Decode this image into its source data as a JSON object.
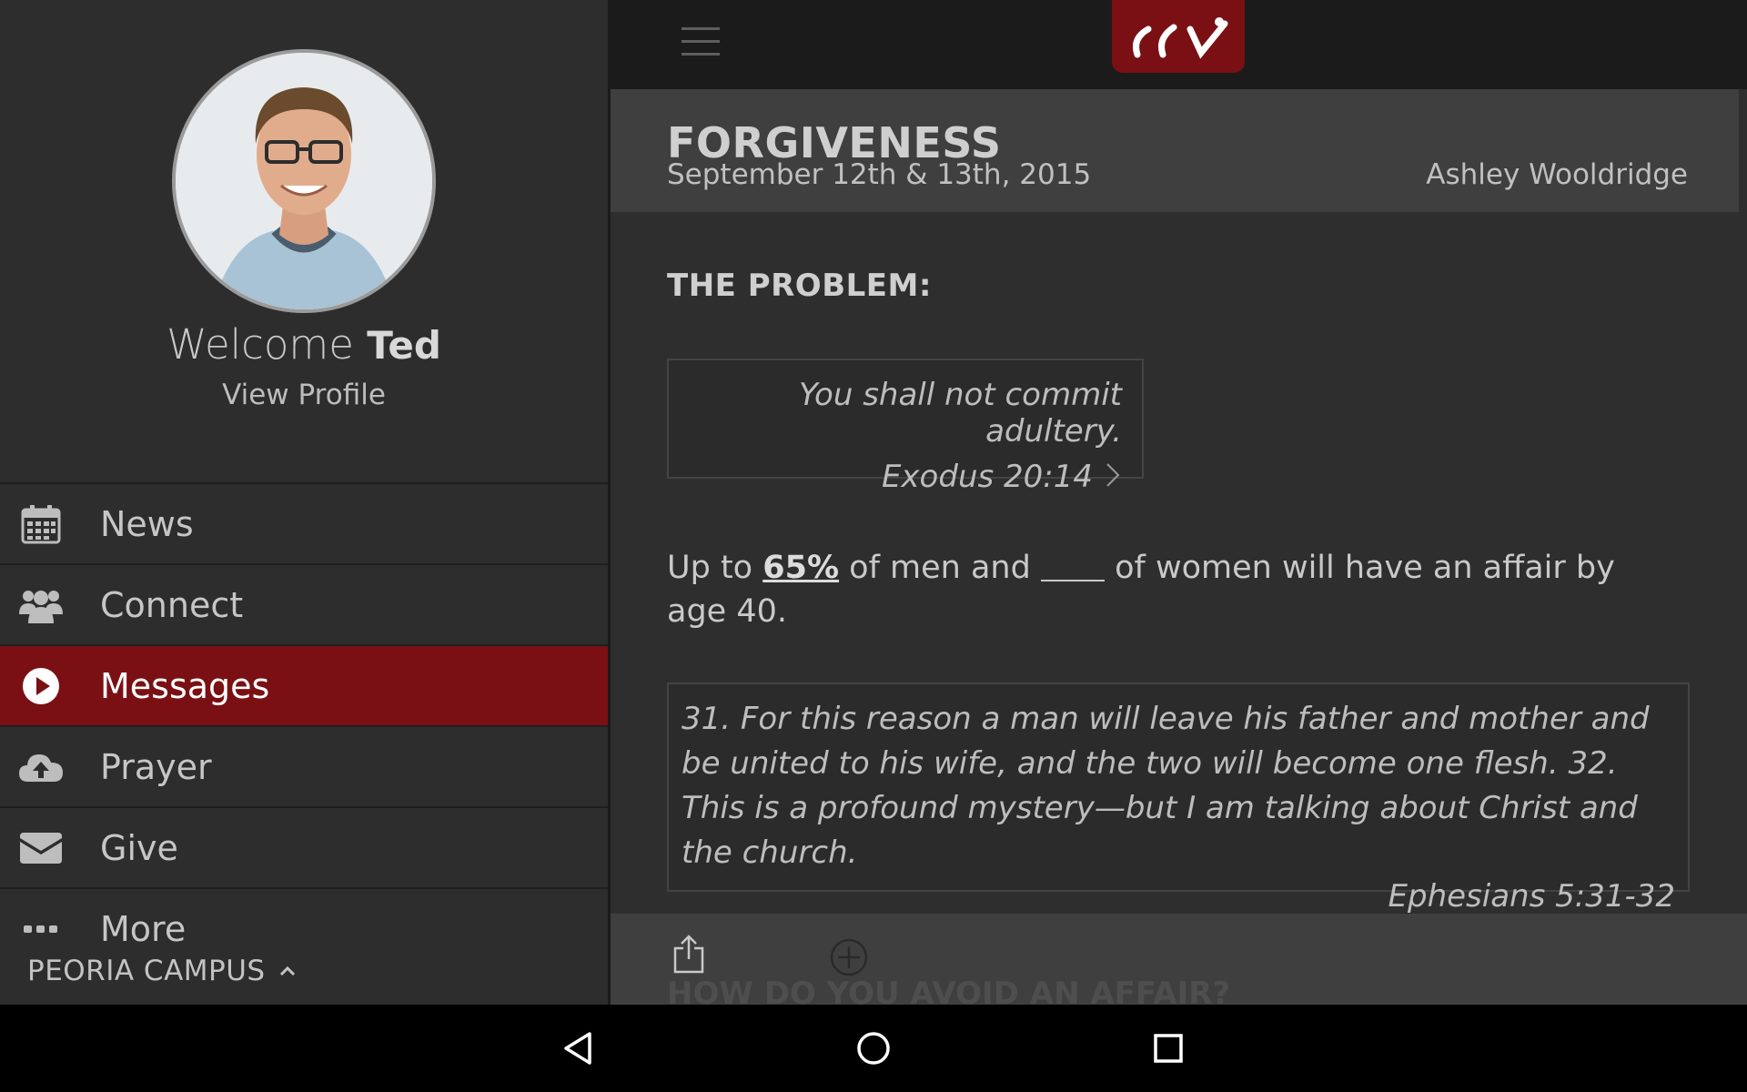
{
  "sidebar": {
    "welcome_prefix": "Welcome",
    "user_name": "Ted",
    "view_profile": "View Profile",
    "items": [
      {
        "label": "News",
        "icon": "calendar-icon"
      },
      {
        "label": "Connect",
        "icon": "group-icon"
      },
      {
        "label": "Messages",
        "icon": "play-circle-icon",
        "active": true
      },
      {
        "label": "Prayer",
        "icon": "cloud-upload-icon"
      },
      {
        "label": "Give",
        "icon": "envelope-icon"
      },
      {
        "label": "More",
        "icon": "ellipsis-icon"
      }
    ],
    "campus": "PEORIA CAMPUS"
  },
  "message": {
    "title": "FORGIVENESS",
    "date": "September 12th & 13th, 2015",
    "speaker": "Ashley Wooldridge",
    "section_heading": "THE PROBLEM:",
    "quote1": {
      "text": "You shall not commit adultery.",
      "ref": "Exodus 20:14"
    },
    "stat": {
      "prefix": "Up to",
      "highlight": "65%",
      "middle": "of men and",
      "suffix": "of women will have an affair by age 40."
    },
    "quote2": {
      "text": "31. For this reason a man will leave his father and mother and be united to his wife, and the two will become one flesh. 32. This is a profound mystery—but I am talking about Christ and the church.",
      "ref": "Ephesians 5:31-32"
    },
    "next_heading": "HOW DO YOU AVOID AN AFFAIR?"
  },
  "colors": {
    "accent": "#7a1014",
    "sidebar_bg": "#2d2d2d",
    "main_bg": "#2e2e2e",
    "topbar_bg": "#1b1b1b",
    "band_bg": "#3f3f3f"
  }
}
